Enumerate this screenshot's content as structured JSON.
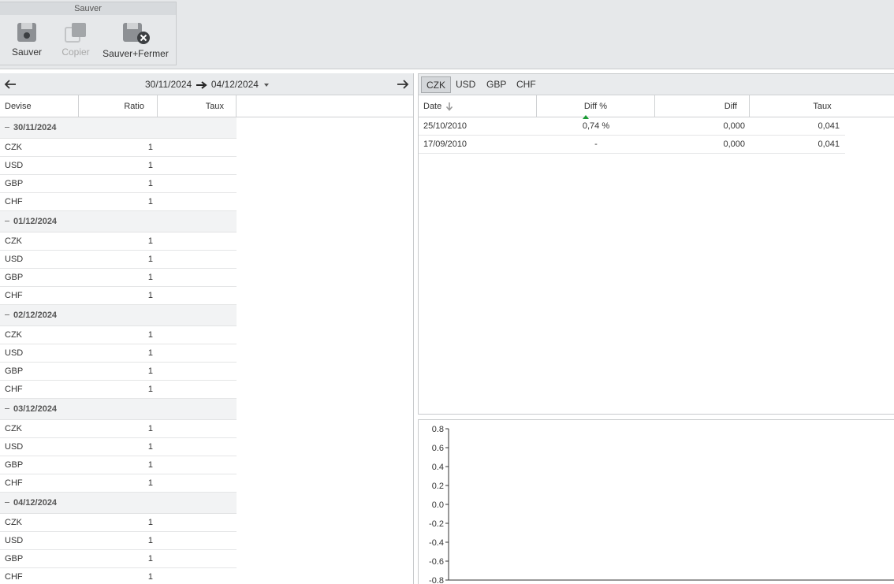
{
  "ribbon": {
    "group_title": "Sauver",
    "buttons": [
      {
        "label": "Sauver",
        "icon": "floppy-disk-icon",
        "enabled": true
      },
      {
        "label": "Copier",
        "icon": "copy-icon",
        "enabled": false
      },
      {
        "label": "Sauver+Fermer",
        "icon": "save-close-icon",
        "enabled": true
      }
    ]
  },
  "left": {
    "range_start": "30/11/2024",
    "range_end": "04/12/2024",
    "columns": [
      "Devise",
      "Ratio",
      "Taux"
    ],
    "groups": [
      {
        "date": "30/11/2024",
        "rows": [
          {
            "devise": "CZK",
            "ratio": "1"
          },
          {
            "devise": "USD",
            "ratio": "1"
          },
          {
            "devise": "GBP",
            "ratio": "1"
          },
          {
            "devise": "CHF",
            "ratio": "1"
          }
        ]
      },
      {
        "date": "01/12/2024",
        "rows": [
          {
            "devise": "CZK",
            "ratio": "1"
          },
          {
            "devise": "USD",
            "ratio": "1"
          },
          {
            "devise": "GBP",
            "ratio": "1"
          },
          {
            "devise": "CHF",
            "ratio": "1"
          }
        ]
      },
      {
        "date": "02/12/2024",
        "rows": [
          {
            "devise": "CZK",
            "ratio": "1"
          },
          {
            "devise": "USD",
            "ratio": "1"
          },
          {
            "devise": "GBP",
            "ratio": "1"
          },
          {
            "devise": "CHF",
            "ratio": "1"
          }
        ]
      },
      {
        "date": "03/12/2024",
        "rows": [
          {
            "devise": "CZK",
            "ratio": "1"
          },
          {
            "devise": "USD",
            "ratio": "1"
          },
          {
            "devise": "GBP",
            "ratio": "1"
          },
          {
            "devise": "CHF",
            "ratio": "1"
          }
        ]
      },
      {
        "date": "04/12/2024",
        "rows": [
          {
            "devise": "CZK",
            "ratio": "1"
          },
          {
            "devise": "USD",
            "ratio": "1"
          },
          {
            "devise": "GBP",
            "ratio": "1"
          },
          {
            "devise": "CHF",
            "ratio": "1"
          }
        ]
      }
    ]
  },
  "right": {
    "tabs": [
      "CZK",
      "USD",
      "GBP",
      "CHF"
    ],
    "active_tab": "CZK",
    "columns": [
      "Date",
      "Diff %",
      "Diff",
      "Taux"
    ],
    "rows": [
      {
        "date": "25/10/2010",
        "diff_pct": "0,74 %",
        "trend": "up",
        "diff": "0,000",
        "taux": "0,041"
      },
      {
        "date": "17/09/2010",
        "diff_pct": "-",
        "trend": "none",
        "diff": "0,000",
        "taux": "0,041"
      }
    ]
  },
  "chart_data": {
    "type": "line",
    "title": "",
    "xlabel": "",
    "ylabel": "",
    "ylim": [
      -0.8,
      0.8
    ],
    "yticks": [
      "0.8",
      "0.6",
      "0.4",
      "0.2",
      "0.0",
      "-0.2",
      "-0.4",
      "-0.6",
      "-0.8"
    ],
    "series": []
  },
  "colors": {
    "up_arrow": "#1a9b34",
    "active_tab_bg": "#d4d7da"
  }
}
